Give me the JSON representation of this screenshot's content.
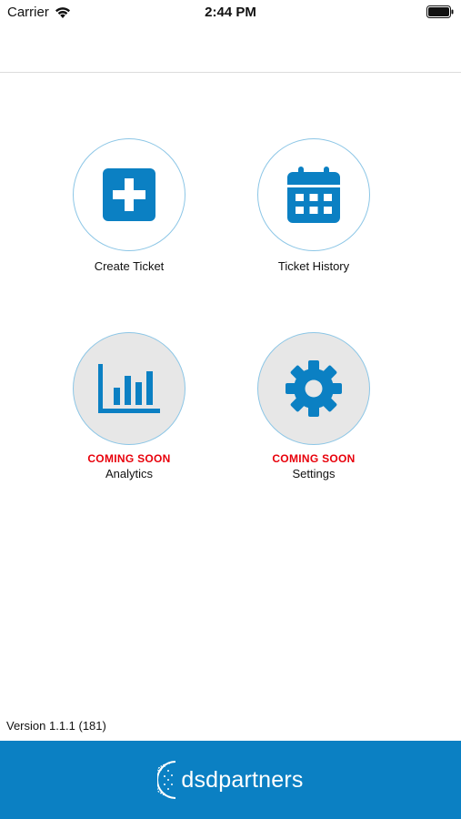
{
  "status_bar": {
    "carrier": "Carrier",
    "time": "2:44 PM",
    "icons": [
      "wifi-icon",
      "battery-icon"
    ]
  },
  "tiles": [
    {
      "label": "Create Ticket",
      "icon": "plus-square-icon",
      "enabled": true
    },
    {
      "label": "Ticket History",
      "icon": "calendar-icon",
      "enabled": true
    },
    {
      "label": "Analytics",
      "icon": "bar-chart-icon",
      "enabled": false,
      "badge": "COMING SOON"
    },
    {
      "label": "Settings",
      "icon": "gear-icon",
      "enabled": false,
      "badge": "COMING SOON"
    }
  ],
  "version": "Version 1.1.1 (181)",
  "footer": {
    "brand": "dsdpartners",
    "logo_icon": "globe-icon"
  },
  "colors": {
    "accent": "#0b80c3",
    "coming_soon": "#e8000b",
    "circle_border": "#8cc6e6",
    "disabled_fill": "#e7e7e7"
  }
}
